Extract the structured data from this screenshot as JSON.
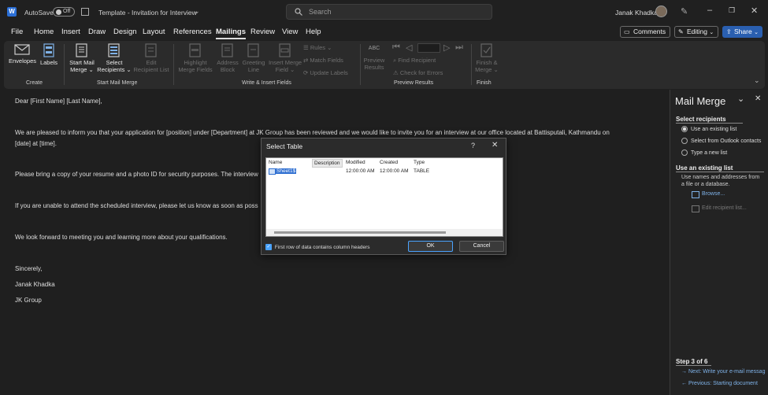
{
  "titlebar": {
    "autosave_label": "AutoSave",
    "autosave_state": "Off",
    "doc_title": "Template - Invitation for Interview",
    "search_placeholder": "Search",
    "user_name": "Janak Khadka"
  },
  "tabs": [
    "File",
    "Home",
    "Insert",
    "Draw",
    "Design",
    "Layout",
    "References",
    "Mailings",
    "Review",
    "View",
    "Help"
  ],
  "active_tab": "Mailings",
  "top_right": {
    "comments": "Comments",
    "editing": "Editing",
    "share": "Share"
  },
  "ribbon": {
    "envelopes": "Envelopes",
    "labels": "Labels",
    "create_group": "Create",
    "start_mail_merge_1": "Start Mail",
    "start_mail_merge_2": "Merge",
    "select_recipients_1": "Select",
    "select_recipients_2": "Recipients",
    "edit_recipient_1": "Edit",
    "edit_recipient_2": "Recipient List",
    "start_group": "Start Mail Merge",
    "highlight_1": "Highlight",
    "highlight_2": "Merge Fields",
    "address_1": "Address",
    "address_2": "Block",
    "greeting_1": "Greeting",
    "greeting_2": "Line",
    "insert_merge_1": "Insert Merge",
    "insert_merge_2": "Field",
    "rules": "Rules",
    "match_fields": "Match Fields",
    "update_labels": "Update Labels",
    "write_group": "Write & Insert Fields",
    "abc": "ABC",
    "preview_1": "Preview",
    "preview_2": "Results",
    "find_recipient": "Find Recipient",
    "check_errors": "Check for Errors",
    "preview_group": "Preview Results",
    "finish_1": "Finish &",
    "finish_2": "Merge",
    "finish_group": "Finish"
  },
  "document": {
    "line1": "Dear [First Name] [Last Name],",
    "line2": "We are pleased to inform you that your application for [position] under [Department] at JK Group has been reviewed and we would like to invite you for an interview at our office located at Battisputali, Kathmandu on",
    "line3": "[date] at [time].",
    "line4": "Please bring a copy of your resume and a photo ID for security purposes. The interview",
    "line5": "If you are unable to attend the scheduled interview, please let us know as soon as poss",
    "line6": "We look forward to meeting you and learning more about your qualifications.",
    "line7": "Sincerely,",
    "line8": "Janak Khadka",
    "line9": "JK Group"
  },
  "dialog": {
    "title": "Select Table",
    "help": "?",
    "columns": [
      "Name",
      "Description",
      "Modified",
      "Created",
      "Type"
    ],
    "row": {
      "name": "Sheet1$",
      "description": "",
      "modified": "12:00:00 AM",
      "created": "12:00:00 AM",
      "type": "TABLE"
    },
    "checkbox_label": "First row of data contains column headers",
    "checkbox_checked": true,
    "ok": "OK",
    "cancel": "Cancel"
  },
  "pane": {
    "title": "Mail Merge",
    "section1": "Select recipients",
    "options": [
      "Use an existing list",
      "Select from Outlook contacts",
      "Type a new list"
    ],
    "selected_option": 0,
    "section2": "Use an existing list",
    "desc1": "Use names and addresses from",
    "desc2": "a file or a database.",
    "browse": "Browse...",
    "edit_list": "Edit recipient list...",
    "step": "Step 3 of 6",
    "next": "Next: Write your e-mail messag",
    "previous": "Previous: Starting document"
  },
  "colors": {
    "accent": "#4aa3ff",
    "selection": "#2f6fd1",
    "share_bg": "#2a5fb0"
  }
}
